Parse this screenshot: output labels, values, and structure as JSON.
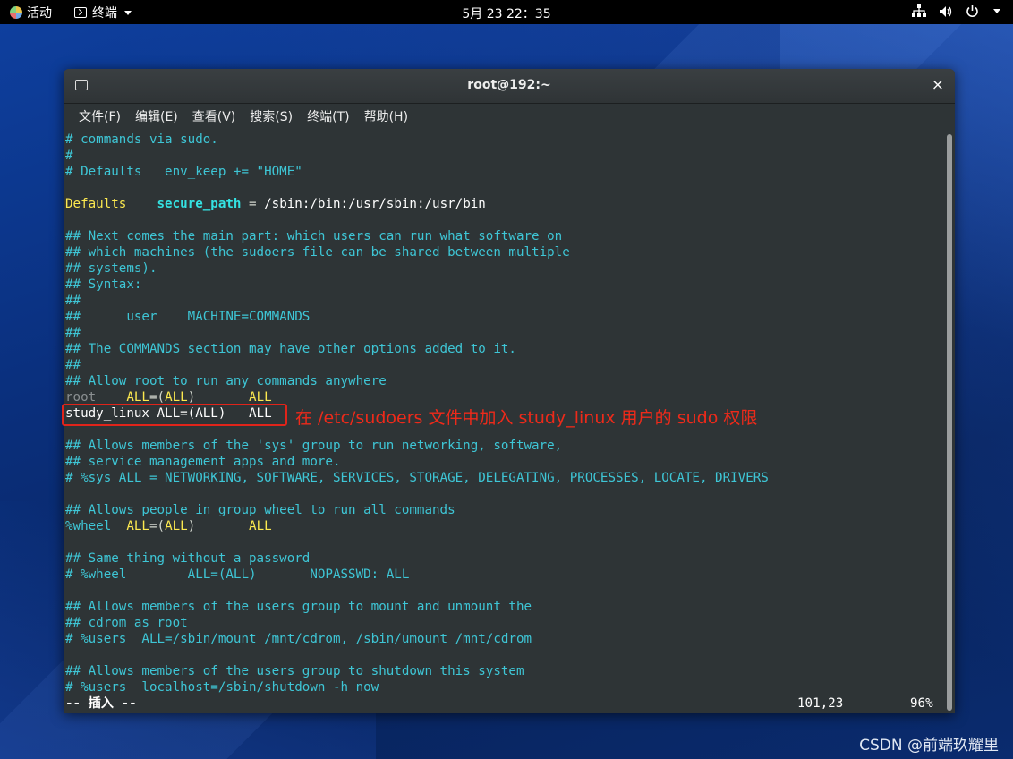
{
  "topbar": {
    "activities": "活动",
    "app_menu": "终端",
    "clock": "5月 23  22：35"
  },
  "window": {
    "title": "root@192:~",
    "close": "×"
  },
  "menubar": {
    "items": [
      "文件(F)",
      "编辑(E)",
      "查看(V)",
      "搜索(S)",
      "终端(T)",
      "帮助(H)"
    ]
  },
  "terminal": {
    "lines": [
      "# commands via sudo.",
      "#",
      "# Defaults   env_keep += \"HOME\"",
      "",
      "Defaults    secure_path = /sbin:/bin:/usr/sbin:/usr/bin",
      "",
      "## Next comes the main part: which users can run what software on",
      "## which machines (the sudoers file can be shared between multiple",
      "## systems).",
      "## Syntax:",
      "##",
      "##      user    MACHINE=COMMANDS",
      "##",
      "## The COMMANDS section may have other options added to it.",
      "##",
      "## Allow root to run any commands anywhere",
      "root    ALL=(ALL)       ALL",
      "study_linux ALL=(ALL)   ALL",
      "",
      "## Allows members of the 'sys' group to run networking, software,",
      "## service management apps and more.",
      "# %sys ALL = NETWORKING, SOFTWARE, SERVICES, STORAGE, DELEGATING, PROCESSES, LOCATE, DRIVERS",
      "",
      "## Allows people in group wheel to run all commands",
      "%wheel  ALL=(ALL)       ALL",
      "",
      "## Same thing without a password",
      "# %wheel        ALL=(ALL)       NOPASSWD: ALL",
      "",
      "## Allows members of the users group to mount and unmount the",
      "## cdrom as root",
      "# %users  ALL=/sbin/mount /mnt/cdrom, /sbin/umount /mnt/cdrom",
      "",
      "## Allows members of the users group to shutdown this system",
      "# %users  localhost=/sbin/shutdown -h now"
    ],
    "status_mode": "-- 插入 --",
    "status_pos": "101,23",
    "status_pct": "96%"
  },
  "annotation": "在 /etc/sudoers 文件中加入 study_linux 用户的 sudo 权限",
  "watermark": "CSDN @前端玖耀里",
  "colors": {
    "comment": "#3ec6d6",
    "keyword": "#fce94f",
    "highlight_box": "#e0241a"
  }
}
